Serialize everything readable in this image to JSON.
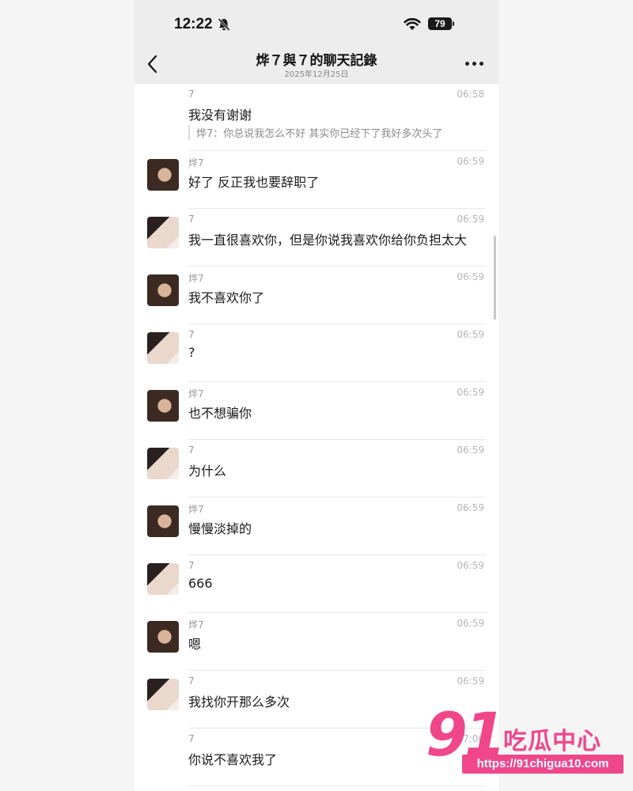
{
  "status_bar": {
    "time": "12:22",
    "battery": "79"
  },
  "nav": {
    "title": "烨７與７的聊天記錄",
    "date": "2025年12月25日"
  },
  "messages": [
    {
      "sender": "7",
      "time": "06:58",
      "text": "我没有谢谢",
      "quote": "烨7：你总说我怎么不好 其实你已经下了我好多次头了"
    },
    {
      "sender": "烨7",
      "time": "06:59",
      "text": "好了 反正我也要辞职了"
    },
    {
      "sender": "7",
      "time": "06:59",
      "text": "我一直很喜欢你，但是你说我喜欢你给你负担太大"
    },
    {
      "sender": "烨7",
      "time": "06:59",
      "text": "我不喜欢你了"
    },
    {
      "sender": "7",
      "time": "06:59",
      "text": "?"
    },
    {
      "sender": "烨7",
      "time": "06:59",
      "text": "也不想骗你"
    },
    {
      "sender": "7",
      "time": "06:59",
      "text": "为什么"
    },
    {
      "sender": "烨7",
      "time": "06:59",
      "text": "慢慢淡掉的"
    },
    {
      "sender": "7",
      "time": "06:59",
      "text": "666"
    },
    {
      "sender": "烨7",
      "time": "06:59",
      "text": "嗯"
    },
    {
      "sender": "7",
      "time": "06:59",
      "text": "我找你开那么多次"
    },
    {
      "sender": "7",
      "time": "07:00",
      "text": "你说不喜欢我了"
    }
  ],
  "watermark": {
    "logo_number": "91",
    "logo_text": "吃瓜中心",
    "url": "https://91chigua10.com"
  }
}
